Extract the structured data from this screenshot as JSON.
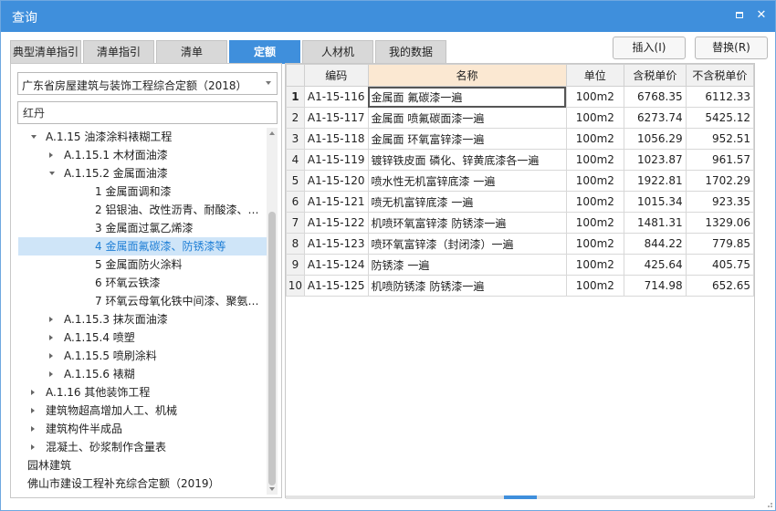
{
  "window": {
    "title": "查询",
    "controls": {
      "restore_icon": "restore-icon",
      "close_icon": "close-icon",
      "close_glyph": "✕"
    }
  },
  "tabs": [
    {
      "label": "典型清单指引",
      "active": false
    },
    {
      "label": "清单指引",
      "active": false
    },
    {
      "label": "清单",
      "active": false
    },
    {
      "label": "定额",
      "active": true
    },
    {
      "label": "人材机",
      "active": false
    },
    {
      "label": "我的数据",
      "active": false
    }
  ],
  "buttons": {
    "insert": "插入(I)",
    "replace": "替换(R)"
  },
  "left": {
    "quota_library": "广东省房屋建筑与装饰工程综合定额（2018）",
    "search_value": "红丹",
    "tree": [
      {
        "label": "A.1.15 油漆涂料裱糊工程",
        "level": 1,
        "toggle": "down"
      },
      {
        "label": "A.1.15.1 木材面油漆",
        "level": 2,
        "toggle": "right"
      },
      {
        "label": "A.1.15.2 金属面油漆",
        "level": 2,
        "toggle": "down"
      },
      {
        "label": "1 金属面调和漆",
        "level": 3,
        "toggle": "none"
      },
      {
        "label": "2 铝银油、改性沥青、耐酸漆、…",
        "level": 3,
        "toggle": "none"
      },
      {
        "label": "3 金属面过氯乙烯漆",
        "level": 3,
        "toggle": "none"
      },
      {
        "label": "4 金属面氟碳漆、防锈漆等",
        "level": 3,
        "toggle": "none",
        "selected": true
      },
      {
        "label": "5 金属面防火涂料",
        "level": 3,
        "toggle": "none"
      },
      {
        "label": "6 环氧云铁漆",
        "level": 3,
        "toggle": "none"
      },
      {
        "label": "7 环氧云母氧化铁中间漆、聚氨…",
        "level": 3,
        "toggle": "none"
      },
      {
        "label": "A.1.15.3 抹灰面油漆",
        "level": 2,
        "toggle": "right"
      },
      {
        "label": "A.1.15.4 喷塑",
        "level": 2,
        "toggle": "right"
      },
      {
        "label": "A.1.15.5 喷刷涂料",
        "level": 2,
        "toggle": "right"
      },
      {
        "label": "A.1.15.6 裱糊",
        "level": 2,
        "toggle": "right"
      },
      {
        "label": "A.1.16 其他装饰工程",
        "level": 1,
        "toggle": "right"
      },
      {
        "label": "建筑物超高增加人工、机械",
        "level": 1,
        "toggle": "right"
      },
      {
        "label": "建筑构件半成品",
        "level": 1,
        "toggle": "right"
      },
      {
        "label": "混凝土、砂浆制作含量表",
        "level": 1,
        "toggle": "right"
      },
      {
        "label": "园林建筑",
        "level": 0,
        "toggle": "right"
      },
      {
        "label": "佛山市建设工程补充综合定额（2019）",
        "level": 0,
        "toggle": "right"
      }
    ]
  },
  "grid": {
    "columns": [
      "",
      "编码",
      "名称",
      "单位",
      "含税单价",
      "不含税单价"
    ],
    "rows": [
      [
        "1",
        "A1-15-116",
        "金属面 氟碳漆一遍",
        "100m2",
        "6768.35",
        "6112.33"
      ],
      [
        "2",
        "A1-15-117",
        "金属面 喷氟碳面漆一遍",
        "100m2",
        "6273.74",
        "5425.12"
      ],
      [
        "3",
        "A1-15-118",
        "金属面 环氧富锌漆一遍",
        "100m2",
        "1056.29",
        "952.51"
      ],
      [
        "4",
        "A1-15-119",
        "镀锌铁皮面 磷化、锌黄底漆各一遍",
        "100m2",
        "1023.87",
        "961.57"
      ],
      [
        "5",
        "A1-15-120",
        "喷水性无机富锌底漆 一遍",
        "100m2",
        "1922.81",
        "1702.29"
      ],
      [
        "6",
        "A1-15-121",
        "喷无机富锌底漆 一遍",
        "100m2",
        "1015.34",
        "923.35"
      ],
      [
        "7",
        "A1-15-122",
        "机喷环氧富锌漆 防锈漆一遍",
        "100m2",
        "1481.31",
        "1329.06"
      ],
      [
        "8",
        "A1-15-123",
        "喷环氧富锌漆（封闭漆）一遍",
        "100m2",
        "844.22",
        "779.85"
      ],
      [
        "9",
        "A1-15-124",
        "防锈漆 一遍",
        "100m2",
        "425.64",
        "405.75"
      ],
      [
        "10",
        "A1-15-125",
        "机喷防锈漆 防锈漆一遍",
        "100m2",
        "714.98",
        "652.65"
      ]
    ],
    "current_row": 0
  },
  "colors": {
    "accent": "#3f8fdc",
    "name_header": "#fbe8d2",
    "selected_tree": "#cfe5f8"
  }
}
